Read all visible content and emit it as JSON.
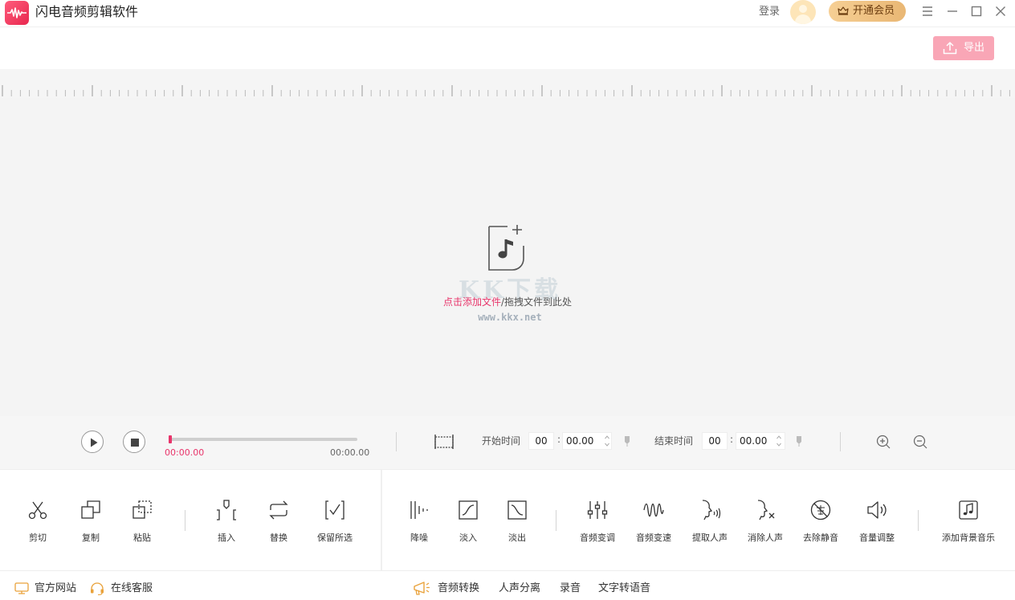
{
  "app": {
    "title": "闪电音频剪辑软件",
    "accent": "#e8346a",
    "vip_color": "#e9b774"
  },
  "header": {
    "login": "登录",
    "vip": "开通会员",
    "export": "导出"
  },
  "drop": {
    "link": "点击添加文件",
    "rest": "/拖拽文件到此处"
  },
  "watermark": {
    "big": "KK下载",
    "small": "www.kkx.net"
  },
  "playback": {
    "current_time": "00:00.00",
    "total_time": "00:00.00",
    "progress": 0,
    "start_label": "开始时间",
    "start_min": "00",
    "start_sec": "00.00",
    "end_label": "结束时间",
    "end_min": "00",
    "end_sec": "00.00",
    "colon": ":"
  },
  "tools": {
    "cut": "剪切",
    "copy": "复制",
    "paste": "粘贴",
    "insert": "插入",
    "replace": "替换",
    "keep": "保留所选",
    "denoise": "降噪",
    "fadein": "淡入",
    "fadeout": "淡出",
    "pitch": "音频变调",
    "speed": "音频变速",
    "extract_vocal": "提取人声",
    "remove_vocal": "消除人声",
    "remove_silence": "去除静音",
    "volume": "音量调整",
    "bgm": "添加背景音乐"
  },
  "footer": {
    "website": "官方网站",
    "service": "在线客服",
    "convert": "音频转换",
    "separate": "人声分离",
    "record": "录音",
    "tts": "文字转语音"
  }
}
